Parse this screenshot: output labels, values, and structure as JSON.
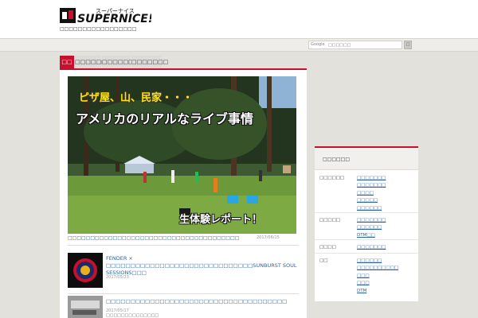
{
  "header": {
    "logo_kana": "スーパーナイス",
    "logo_text": "SUPERNICE!",
    "tagline": "□□□□□□□□□□□□□□□□□"
  },
  "search": {
    "provider_label": "Google",
    "placeholder": "□□□□□□",
    "button_label": "□"
  },
  "tabs": [
    {
      "label": "□□"
    },
    {
      "label": "□□□□□□"
    },
    {
      "label": "□□□□□□□"
    },
    {
      "label": "□□□□□□□"
    }
  ],
  "featured": {
    "image_caption_top": "ピザ屋、山、民家・・・",
    "image_caption_main": "アメリカのリアルなライブ事情",
    "image_caption_bottom": "生体験レポート！",
    "title": "□□□□□□□□□□□□□□□□□□□□□□□□□□□□□□□□□□□□□□",
    "date": "2017/08/15"
  },
  "posts": [
    {
      "title": "FENDER × □□□□□□□□□□□□□□□□□□□□□□□□□□□□□□SUNBURST SOUL SESSIONS□□□",
      "date": "2017/05/23"
    },
    {
      "title": "□□□□□□□□□□□□□□□□□□□□□□□□□□□□□□□□□□□□□",
      "date": "2017/05/17",
      "category": "□□□□□□□□□□□□□□"
    }
  ],
  "sidebar": {
    "title": "□□□□□□",
    "groups": [
      {
        "name": "□□□□□□",
        "links": [
          "□□□□□□□",
          "□□□□□□□",
          "□□□□",
          "□□□□□",
          "□□□□□□"
        ]
      },
      {
        "name": "□□□□□",
        "links": [
          "□□□□□□□",
          "□□□□□□",
          "DTM□□"
        ]
      },
      {
        "name": "□□□□",
        "links": [
          "□□□□□□□"
        ]
      },
      {
        "name": "□□",
        "links": [
          "□□□□□□",
          "□□□□□□□□□□",
          "□□□",
          "□□□",
          "DTM"
        ]
      }
    ]
  },
  "colors": {
    "accent": "#c8102e",
    "link": "#2b63a3",
    "page_bg": "#e3e1dc"
  }
}
